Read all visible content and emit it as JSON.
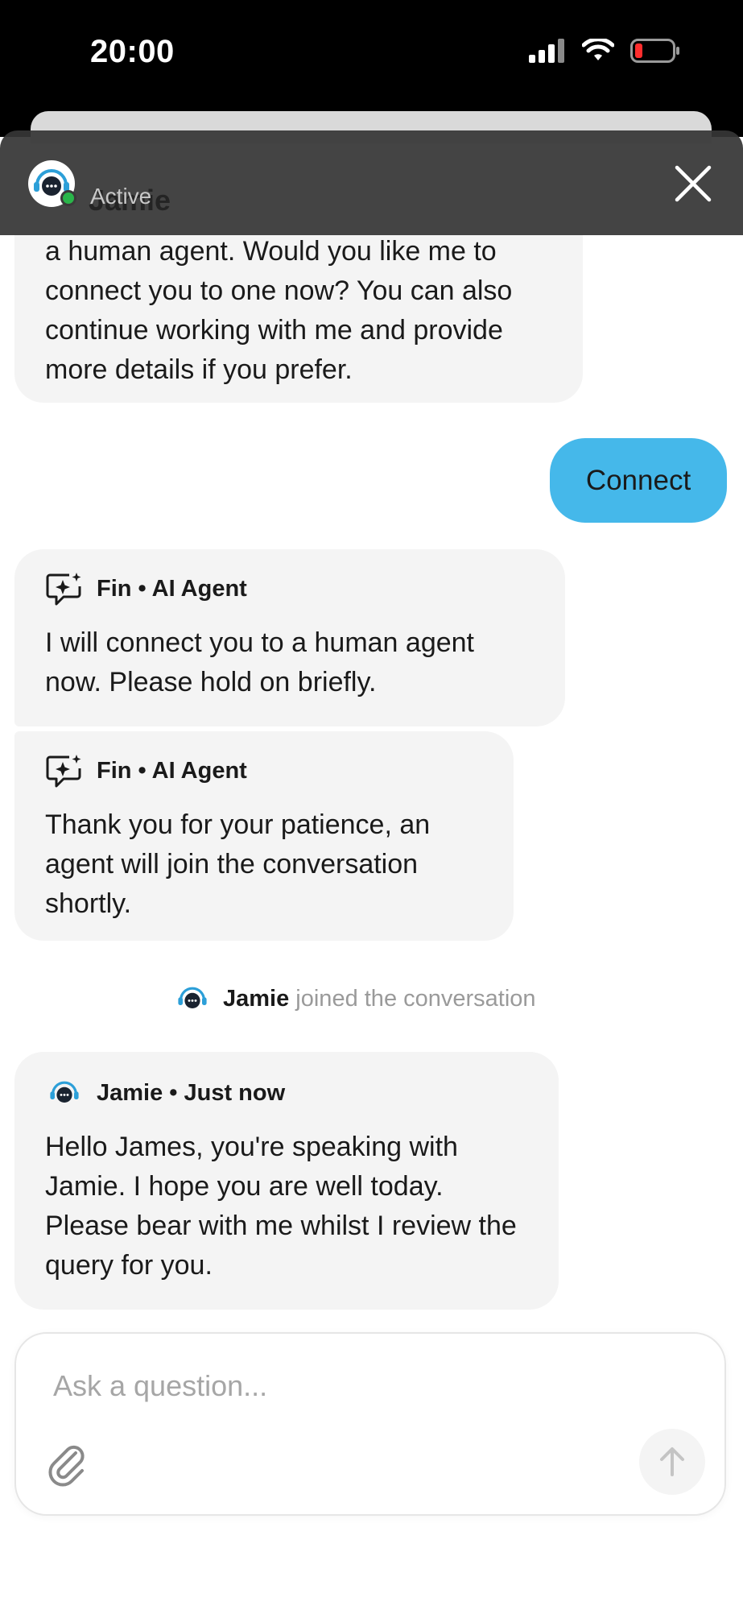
{
  "status_bar": {
    "time": "20:00"
  },
  "header": {
    "name": "Jamie",
    "status": "Active"
  },
  "messages": {
    "bot_prev_text": "a human agent. Would you like me to connect you to one now? You can also continue working with me and provide more details if you prefer.",
    "user_reply": "Connect",
    "fin1": {
      "name": "Fin • AI Agent",
      "text": "I will connect you to a human agent now. Please hold on briefly."
    },
    "fin2": {
      "name": "Fin • AI Agent",
      "text": "Thank you for your patience, an agent will join the conversation shortly."
    },
    "joined": {
      "name": "Jamie",
      "text": "joined the conversation"
    },
    "jamie": {
      "name": "Jamie • Just now",
      "text": "Hello James, you're speaking with Jamie. I hope you are well today. Please bear with me whilst I review the query for you."
    }
  },
  "composer": {
    "placeholder": "Ask a question..."
  },
  "colors": {
    "user_bubble": "#45b8ea",
    "online": "#2ab54a",
    "header_bg": "#363636",
    "bubble_bg": "#f4f4f4"
  },
  "icons": {
    "signal": "signal-icon",
    "wifi": "wifi-icon",
    "battery": "battery-icon",
    "close": "close-icon",
    "agent_avatar": "support-agent-avatar-icon",
    "ai_sparkle": "ai-sparkle-icon",
    "attach": "paperclip-icon",
    "send": "arrow-up-icon"
  }
}
